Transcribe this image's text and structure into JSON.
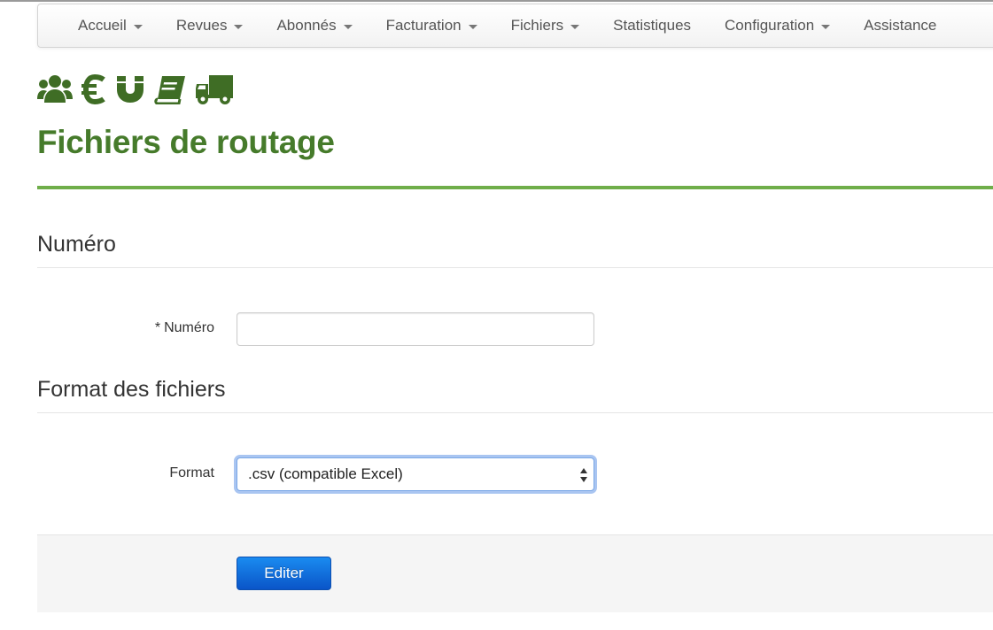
{
  "navbar": {
    "items": [
      {
        "label": "Accueil",
        "dropdown": true
      },
      {
        "label": "Revues",
        "dropdown": true
      },
      {
        "label": "Abonnés",
        "dropdown": true
      },
      {
        "label": "Facturation",
        "dropdown": true
      },
      {
        "label": "Fichiers",
        "dropdown": true
      },
      {
        "label": "Statistiques",
        "dropdown": false
      },
      {
        "label": "Configuration",
        "dropdown": true
      },
      {
        "label": "Assistance",
        "dropdown": false
      }
    ]
  },
  "icon_bar": {
    "color": "#3f6d25",
    "icons": [
      "users-icon",
      "euro-icon",
      "magnet-icon",
      "book-icon",
      "truck-icon"
    ]
  },
  "page": {
    "title": "Fichiers de routage",
    "accent_color": "#467b2b",
    "rule_color": "#6fae4a"
  },
  "sections": {
    "numero": {
      "legend": "Numéro",
      "required_marker": "*",
      "label": "Numéro",
      "value": "",
      "placeholder": ""
    },
    "format": {
      "legend": "Format des fichiers",
      "label": "Format",
      "selected": ".csv (compatible Excel)"
    }
  },
  "actions": {
    "submit_label": "Editer",
    "button_color": "#0a55c8"
  }
}
